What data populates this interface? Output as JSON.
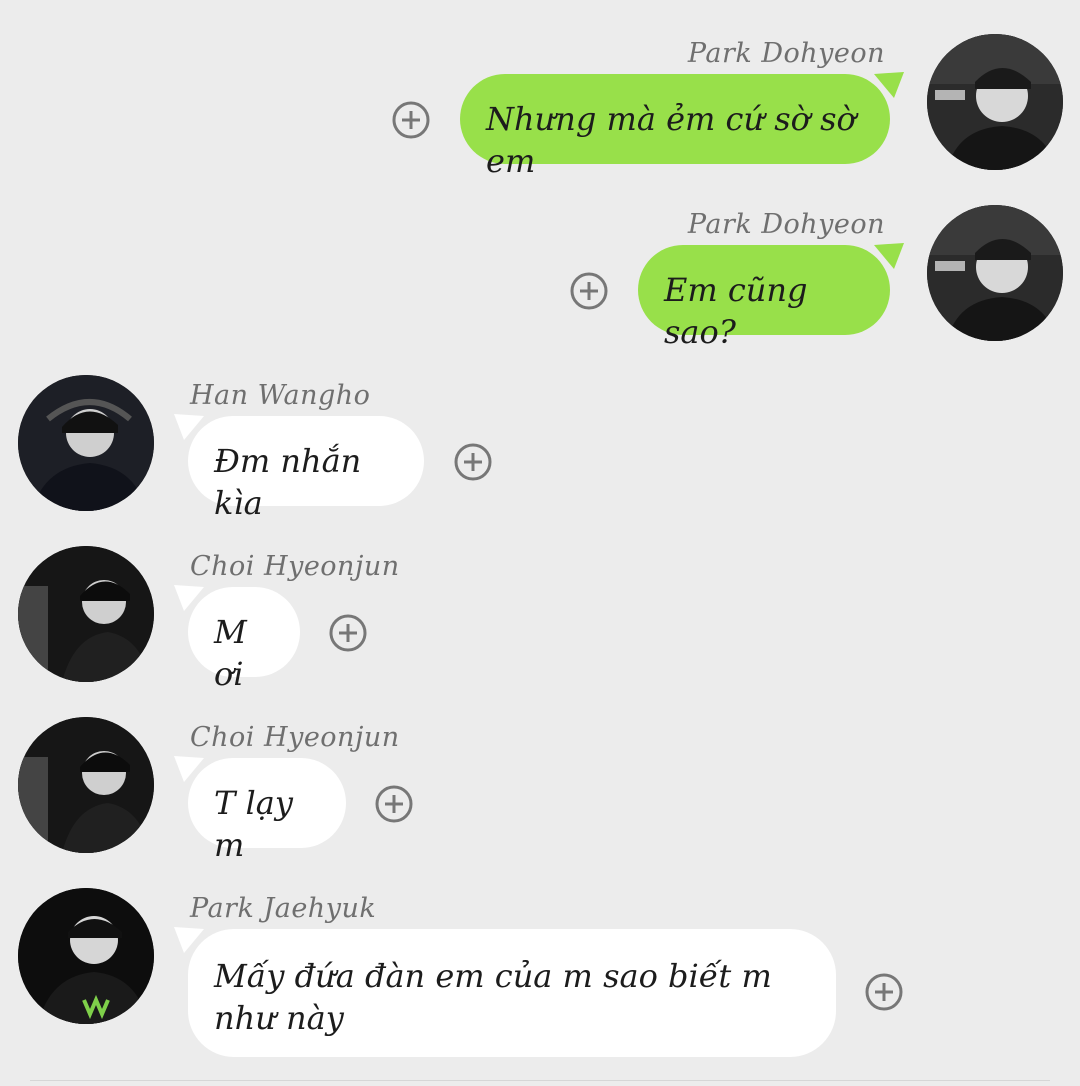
{
  "messages": [
    {
      "sender": "Park Dohyeon",
      "text": "Nhưng mà ẻm cứ sờ sờ em",
      "side": "sent",
      "avatar": "player-photo-avatar"
    },
    {
      "sender": "Park Dohyeon",
      "text": "Em cũng sao?",
      "side": "sent",
      "avatar": "player-photo-avatar"
    },
    {
      "sender": "Han Wangho",
      "text": "Đm nhắn kìa",
      "side": "received",
      "avatar": "player-photo-avatar"
    },
    {
      "sender": "Choi Hyeonjun",
      "text": "M ơi",
      "side": "received",
      "avatar": "player-photo-avatar"
    },
    {
      "sender": "Choi Hyeonjun",
      "text": "T lạy m",
      "side": "received",
      "avatar": "player-photo-avatar"
    },
    {
      "sender": "Park Jaehyuk",
      "text": "Mấy đứa đàn em của m sao biết m như này",
      "side": "received",
      "avatar": "player-photo-avatar"
    }
  ],
  "colors": {
    "background": "#ececec",
    "sent_bubble": "#98e04a",
    "received_bubble": "#ffffff",
    "name_text": "#6f6f6f",
    "plus_icon": "#777777"
  },
  "icons": {
    "add": "plus-circle-icon"
  }
}
